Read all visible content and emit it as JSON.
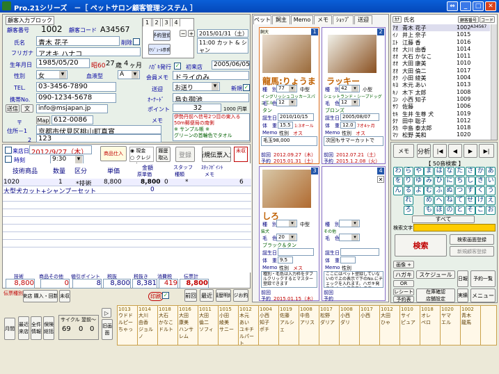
{
  "window": {
    "title": "Pro.21シリーズ　－［ ペットサロン顧客管理システム ］"
  },
  "customer": {
    "section_label": "顧客入力ブロック",
    "number_label": "顧客番号",
    "number": "1002",
    "code_label": "顧客コード",
    "code": "A34567",
    "name_label": "氏名",
    "name": "青木 花子",
    "resigned_label": "削除",
    "kana_label": "フリガナ",
    "kana": "アオキ ハナコ",
    "birth_label": "生年月日",
    "birth": "1985/05/20",
    "era": "昭60",
    "age": "27",
    "age_unit": "歳",
    "months": "4",
    "months_unit": "ヶ月",
    "gender_label": "性別",
    "gender": "女",
    "blood_label": "血液型",
    "blood": "A",
    "tel_label": "TEL.",
    "tel": "03-3456-7890",
    "mobile_label": "携帯No.",
    "mobile": "090-1234-5678",
    "mail_btn": "送信",
    "mail_btn2": "文",
    "email": "info@msjapan.jp",
    "zip_label": "〒",
    "map_btn": "Map",
    "zip": "612-0086",
    "address_label": "住所－1",
    "address1": "京都市伏見区桃山町真宵",
    "address_label2": "2",
    "address2": "123",
    "dm_label": "ﾊｶﾞｷ発行",
    "first_visit_label": "初来店",
    "first_visit": "2005/06/05",
    "memo_label": "会員メモ",
    "memo": "ドライのみ",
    "delivery_label": "送迎",
    "delivery": "お送り",
    "new_label": "新規",
    "owner_label": "ｵｰﾅｰﾄﾞ",
    "owner": "烏丸御池",
    "points_label": "ポイント",
    "points": "32",
    "points_note": "1000 円単位",
    "memo2_label": "メモ",
    "memo2_line1": "伊勢丹前へ信号2つ目の東入る",
    "memo2_line2": "50m郵便局の南側",
    "memo2_line3": "※ サンプル帳 ※",
    "memo2_line4": "グリーンの首輪色でタオル"
  },
  "reservation": {
    "tabs": [
      "1",
      "2",
      "3",
      "4"
    ],
    "yoyaku_btn": "予約登録",
    "schedule_btn": "ｽｹｼﾞｭｰﾙ参照",
    "date": "2015/01/31（土）",
    "line1": "11:00 カット & シャン",
    "line2": "プー"
  },
  "visit": {
    "date_label": "来店日",
    "date": "2012/9/27（木）",
    "time_label": "時刻",
    "time": "9:30",
    "goods_btn": "商品仕入",
    "cash_label": "現金",
    "credit_label": "クレジット",
    "register_btn": "登録",
    "new_btn": "新規伝票入力",
    "unsent_label": "未収",
    "history_btn": "履歴",
    "history_btn2": "取込",
    "col_item": "技術商品",
    "col_qty": "数量",
    "col_kubun": "区分",
    "col_price": "単価",
    "col_amount": "金額",
    "col_amount2": "原単価",
    "col_staff": "スタッフ",
    "col_staff2": "種類",
    "col_point": "ｽﾀｯﾌﾎﾟｲﾝﾄ",
    "col_point2": "メモ",
    "row1_code": "1020",
    "row1_qty": "1",
    "row1_mark": "*技術",
    "row1_price": "8,800",
    "row1_amount": "8,800",
    "row1_zero": "0",
    "row1_star": "*",
    "row1_six": "6",
    "row2_name": "大型犬カット+シャンプーセット",
    "row2_zero": "0"
  },
  "totals": {
    "tech_label": "技術",
    "goods_label": "商品その他",
    "disc_label": "値引ポイント",
    "subtotal_label": "税抜",
    "tax_label": "税抜き",
    "cons_label": "消費税",
    "total_label": "伝票計",
    "tech": "8,800",
    "goods": "0",
    "disc": "8",
    "subtotal": "8,800",
    "taxfree": "8,381",
    "tax": "419",
    "total": "8,800",
    "print_btn": "印刷",
    "prev_btn": "前回",
    "latest_btn": "最近",
    "history_btn": "履歴明細",
    "register_btn": "レジお釣り",
    "receipt_label": "領収",
    "pay_label": "伝票種別",
    "pay_btn": "来店 購入・回数",
    "count1": "5",
    "count2": "4",
    "unpaid_btn": "未収"
  },
  "pet_tabs": [
    "ペット",
    "飼主",
    "Memo",
    "メモ",
    "ｼｮｯﾌﾟ",
    "送迎"
  ],
  "pets": [
    {
      "num": "1",
      "tag": "飼大",
      "name": "龍馬:りょうま",
      "breed_label": "種　別",
      "breed": "77",
      "size": "中型",
      "breed_name": "イングリッシュコッカースパニエル",
      "color_label": "毛　色",
      "color": "12",
      "coat": "タン",
      "birth_label": "誕生日",
      "birth": "2010/10/15",
      "weight_label": "体　重",
      "weight": "15.5",
      "weight2": "1:3オール",
      "memo_label": "Memo",
      "sex_label": "性別",
      "sex": "オス",
      "memo": "毛玉98,000",
      "prev_label": "前回",
      "prev": "2012.09.27（木）",
      "next_label": "予約",
      "next": "2015.01.31（土）"
    },
    {
      "num": "2",
      "tag": "",
      "name": "ラッキー",
      "breed_label": "種　別",
      "breed": "42",
      "size": "小型",
      "breed_name": "シェットランド・シープドッグ",
      "color_label": "毛　色",
      "color": "12",
      "coat": "ブロンズ",
      "birth_label": "誕生日",
      "birth": "2005/08/07",
      "weight_label": "体　重",
      "weight": "12.0",
      "weight2": "7才4ヶ月",
      "memo_label": "Memo",
      "sex_label": "性別",
      "sex": "オス",
      "memo": "次回もサマーカットで",
      "prev_label": "前回",
      "prev": "2012.07.21（土）",
      "next_label": "予約",
      "next": "2015.1.2.08（火）"
    },
    {
      "num": "3",
      "tag": "",
      "name": "しろ",
      "breed_label": "種　別",
      "breed": "",
      "size": "中型",
      "breed_name": "柴犬",
      "color_label": "毛　色",
      "color": "20",
      "coat": "ブラック＆タン",
      "birth_label": "誕生日",
      "birth": "",
      "weight_label": "体　重",
      "weight": "9.5",
      "weight2": "",
      "memo_label": "Memo",
      "sex_label": "性別",
      "sex": "メス",
      "memo": "種別・毛色は入力枠をダブルクリックするとマスター登録できます",
      "prev_label": "前回",
      "prev": "",
      "next_label": "予約",
      "next": "2015.01.15（木）"
    },
    {
      "num": "4",
      "tag": "",
      "name": "",
      "breed_label": "種　別",
      "breed": "",
      "size": "",
      "breed_name": "その他",
      "color_label": "毛　色",
      "color": "",
      "coat": "",
      "birth_label": "誕生日",
      "birth": "",
      "weight_label": "体　重",
      "weight": "",
      "weight2": "",
      "memo_label": "Memo",
      "sex_label": "性別",
      "sex": "",
      "memo": "ここにはペット登録していないので上の表示で下のNo.にチェックを入れます。ハガキ発名にペット名表示します",
      "prev_label": "前回",
      "prev": "",
      "next_label": "予約",
      "next": ""
    }
  ],
  "customer_list": {
    "tabs": [
      "ｶﾅ",
      "氏名",
      "顧客番号",
      "コード"
    ],
    "rows": [
      {
        "kana": "ｱｵ",
        "name": "青木 花子",
        "no": "1002",
        "code": "A34567"
      },
      {
        "kana": "ｲﾉ",
        "name": "井上 奈子",
        "no": "1015",
        "code": ""
      },
      {
        "kana": "ｴﾄ",
        "name": "江藤 香",
        "no": "1016",
        "code": ""
      },
      {
        "kana": "ｵｵ",
        "name": "大川 由香",
        "no": "1014",
        "code": ""
      },
      {
        "kana": "ｵｵ",
        "name": "大石 かなこ",
        "no": "1011",
        "code": ""
      },
      {
        "kana": "ｵｵ",
        "name": "大田 康美",
        "no": "1010",
        "code": ""
      },
      {
        "kana": "ｵｵ",
        "name": "大田 倫二",
        "no": "1017",
        "code": ""
      },
      {
        "kana": "ｵｸ",
        "name": "小田 綾美",
        "no": "1004",
        "code": ""
      },
      {
        "kana": "ｷﾖ",
        "name": "木元 あい",
        "no": "1013",
        "code": ""
      },
      {
        "kana": "ｷﾉ",
        "name": "木下 太郎",
        "no": "1008",
        "code": ""
      },
      {
        "kana": "ｺﾝ",
        "name": "小西 知子",
        "no": "1009",
        "code": ""
      },
      {
        "kana": "ｻﾜ",
        "name": "佐藤",
        "no": "1006",
        "code": ""
      },
      {
        "kana": "ｾｷ",
        "name": "生井 生尊 犬",
        "no": "1019",
        "code": ""
      },
      {
        "kana": "ﾀﾅ",
        "name": "田中 聡子",
        "no": "1012",
        "code": ""
      },
      {
        "kana": "ﾀｶ",
        "name": "中島 泰太郎",
        "no": "1018",
        "code": ""
      },
      {
        "kana": "ﾏﾂ",
        "name": "松野 美和",
        "no": "1020",
        "code": ""
      }
    ]
  },
  "search": {
    "memo_tab": "メモ",
    "analysis_btn": "分析",
    "kana_header": "【 50音検索 】",
    "kana_rows": [
      [
        "わ",
        "ら",
        "や",
        "ま",
        "は",
        "な",
        "た",
        "さ",
        "か",
        "あ"
      ],
      [
        "を",
        "り",
        "ゆ",
        "み",
        "ひ",
        "に",
        "ち",
        "し",
        "き",
        "い"
      ],
      [
        "ん",
        "る",
        "よ",
        "む",
        "ふ",
        "ぬ",
        "つ",
        "す",
        "く",
        "う"
      ],
      [
        "",
        "れ",
        "",
        "め",
        "へ",
        "ね",
        "て",
        "せ",
        "け",
        "え"
      ],
      [
        "",
        "ろ",
        "",
        "も",
        "ほ",
        "の",
        "と",
        "そ",
        "こ",
        "お"
      ]
    ],
    "all_btn": "すべて",
    "search_label": "検索文字",
    "search_value": "",
    "search_btn": "検索",
    "new_search_btn": "検索画面登録",
    "new_cust_btn": "新規顧客登録",
    "image_btn": "画像 +",
    "hagaki_btn": "ハガキ",
    "schedule_btn": "スケジュール",
    "or_btn": "OR",
    "nichiji_btn": "日報",
    "yoyaku_list_btn": "予約一覧",
    "receipt_btn": "レシート",
    "stock_btn": "在庫確認",
    "stock_btn2": "店舗設定",
    "actual_btn": "実績",
    "menu_btn": "メニュー",
    "closed_btn": "締め",
    "appointment_btn": "予約表"
  },
  "bottom": {
    "month_btn": "月間",
    "recent_btn": "最近来店",
    "all_btn": "全件情報",
    "total_btn": "保険総括",
    "cycle_label": "サイクル",
    "cycle_from": "翌前～",
    "cycle_a": "69",
    "cycle_b": "0",
    "cycle_c": "0",
    "return_btn": "旧画面",
    "calendar": [
      {
        "no": "1013",
        "lines": [
          "ウドド",
          "ルピー",
          "ちゃっ"
        ]
      },
      {
        "no": "1014",
        "lines": [
          "大川",
          "由香",
          "ジョルノ"
        ]
      },
      {
        "no": "1018",
        "lines": [
          "大石",
          "かなこ",
          "ドルト"
        ]
      },
      {
        "no": "1016",
        "lines": [
          "大田",
          "康美",
          "ハンサ",
          "レム"
        ]
      },
      {
        "no": "1011",
        "lines": [
          "大田",
          "倫二",
          "ソフィ"
        ]
      },
      {
        "no": "1015",
        "lines": [
          "小田",
          "綾美",
          "サニー"
        ]
      },
      {
        "no": "1012",
        "lines": [
          "木元",
          "あい",
          "ユキチ",
          "ルパート"
        ]
      },
      {
        "no": "1004",
        "lines": [
          "小西",
          "知子",
          "ポチ"
        ]
      },
      {
        "no": "1019",
        "lines": [
          "佐藤",
          "アルシェ"
        ]
      },
      {
        "no": "1008",
        "lines": [
          "中島",
          "アリス"
        ]
      },
      {
        "no": "1017",
        "lines": [
          "松野",
          "ダリア"
        ]
      },
      {
        "no": "1008",
        "lines": [
          "小西",
          "ダリ"
        ]
      },
      {
        "no": "1017",
        "lines": [
          "小西"
        ]
      },
      {
        "no": "1012",
        "lines": [
          "大田",
          "ひゃ"
        ]
      },
      {
        "no": "1010",
        "lines": [
          "サイ",
          "ピュア"
        ]
      },
      {
        "no": "1018",
        "lines": [
          "オレ",
          "ペロ"
        ]
      },
      {
        "no": "1020",
        "lines": [
          "ヤマ",
          "エル"
        ]
      },
      {
        "no": "1002",
        "lines": [
          "青木",
          "龍馬"
        ]
      }
    ]
  }
}
